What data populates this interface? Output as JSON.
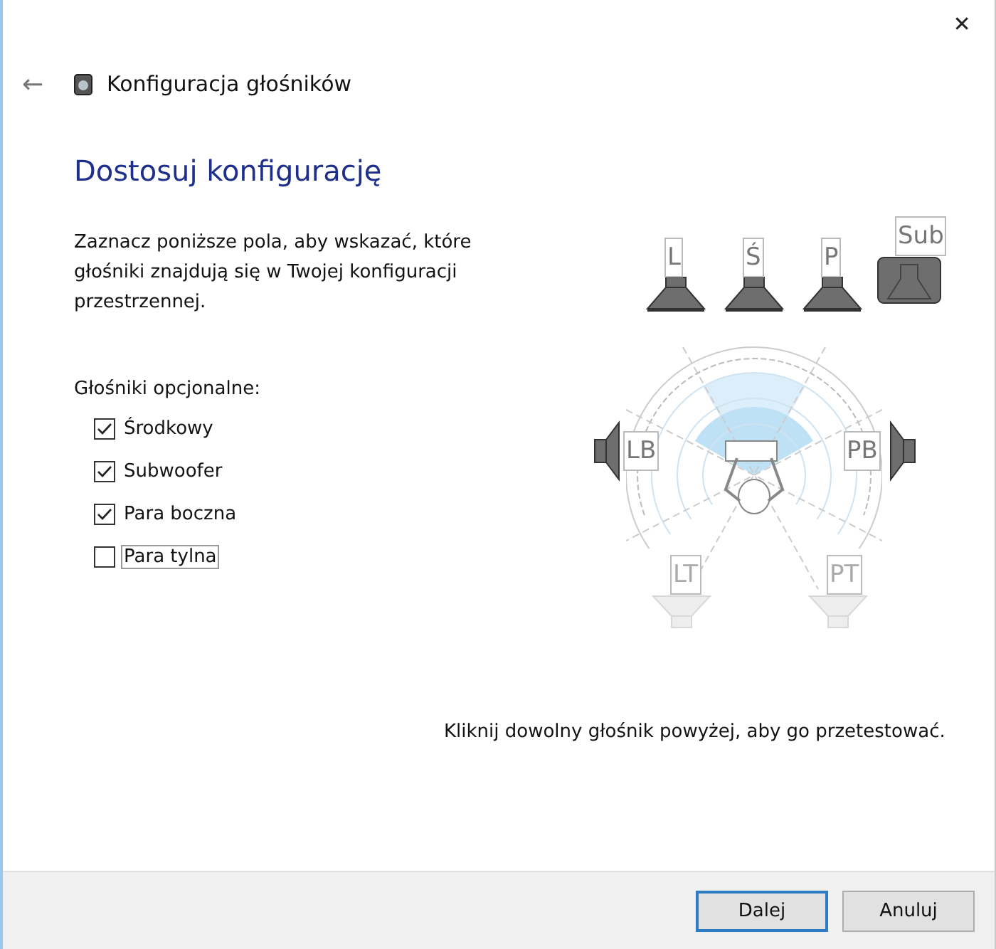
{
  "window": {
    "title": "Konfiguracja głośników",
    "close": "✕",
    "back": "←"
  },
  "heading": "Dostosuj konfigurację",
  "description": "Zaznacz poniższe pola, aby wskazać, które głośniki znajdują się w Twojej konfiguracji przestrzennej.",
  "options_label": "Głośniki opcjonalne:",
  "options": [
    {
      "label": "Środkowy",
      "checked": true,
      "focused": false
    },
    {
      "label": "Subwoofer",
      "checked": true,
      "focused": false
    },
    {
      "label": "Para boczna",
      "checked": true,
      "focused": false
    },
    {
      "label": "Para tylna",
      "checked": false,
      "focused": true
    }
  ],
  "speakers": [
    {
      "label": "L",
      "kind": "front",
      "active": true
    },
    {
      "label": "Ś",
      "kind": "front",
      "active": true
    },
    {
      "label": "P",
      "kind": "front",
      "active": true
    },
    {
      "label": "Sub",
      "kind": "sub",
      "active": true
    },
    {
      "label": "LB",
      "kind": "left",
      "active": true
    },
    {
      "label": "PB",
      "kind": "right",
      "active": true
    },
    {
      "label": "LT",
      "kind": "rear",
      "active": false
    },
    {
      "label": "PT",
      "kind": "rear",
      "active": false
    }
  ],
  "hint": "Kliknij dowolny głośnik powyżej, aby go przetestować.",
  "buttons": [
    {
      "label": "Dalej",
      "default": true
    },
    {
      "label": "Anuluj",
      "default": false
    }
  ]
}
